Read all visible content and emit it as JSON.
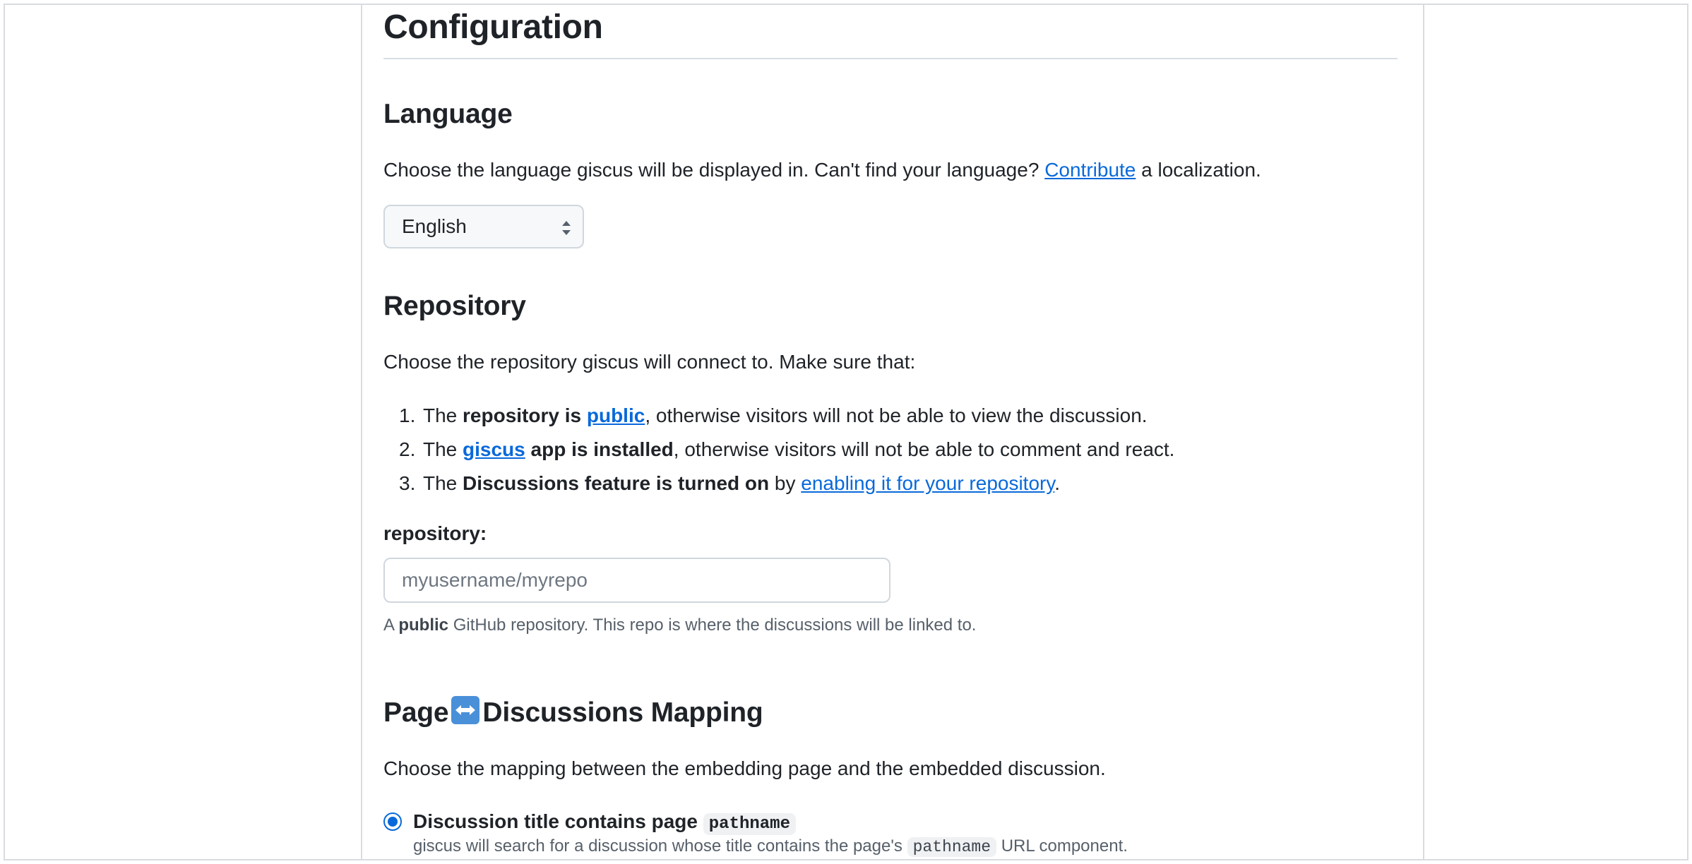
{
  "page": {
    "title": "Configuration"
  },
  "language": {
    "heading": "Language",
    "description_before": "Choose the language giscus will be displayed in. Can't find your language? ",
    "contribute_link": "Contribute",
    "description_after": " a localization.",
    "selected": "English"
  },
  "repository": {
    "heading": "Repository",
    "intro": "Choose the repository giscus will connect to. Make sure that:",
    "requirements": [
      {
        "num": "1.",
        "pre": "The ",
        "bold1": "repository is ",
        "link": "public",
        "post": ", otherwise visitors will not be able to view the discussion."
      },
      {
        "num": "2.",
        "pre": "The ",
        "link": "giscus",
        "bold2": " app is installed",
        "post": ", otherwise visitors will not be able to comment and react."
      },
      {
        "num": "3.",
        "pre": "The ",
        "bold1": "Discussions feature is turned on",
        "mid": " by ",
        "link": "enabling it for your repository",
        "post": "."
      }
    ],
    "field_label": "repository:",
    "input_value": "",
    "input_placeholder": "myusername/myrepo",
    "hint_pre": "A ",
    "hint_bold": "public",
    "hint_post": " GitHub repository. This repo is where the discussions will be linked to."
  },
  "mapping": {
    "heading_pre": "Page",
    "heading_post": "Discussions Mapping",
    "intro": "Choose the mapping between the embedding page and the embedded discussion.",
    "option1": {
      "title": "Discussion title contains page ",
      "code": "pathname",
      "desc_pre": "giscus will search for a discussion whose title contains the page's ",
      "desc_code": "pathname",
      "desc_post": " URL component."
    }
  },
  "colors": {
    "link": "#0969da",
    "text": "#1f2328",
    "muted": "#57606a",
    "border": "#d0d7de"
  },
  "icons": {
    "select": "chevron-up-down-icon",
    "mapping": "left-right-arrow-emoji"
  }
}
